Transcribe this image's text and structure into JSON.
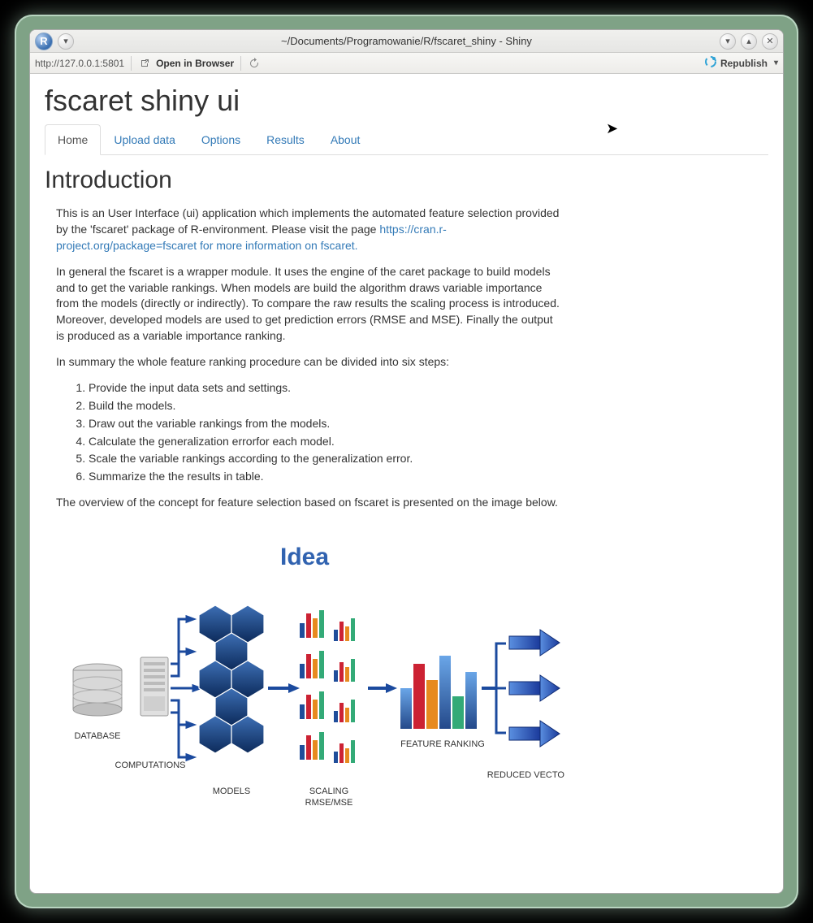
{
  "window": {
    "title": "~/Documents/Programowanie/R/fscaret_shiny - Shiny"
  },
  "toolbar": {
    "address": "http://127.0.0.1:5801",
    "open_in_browser": "Open in Browser",
    "republish": "Republish"
  },
  "page": {
    "title": "fscaret shiny ui",
    "tabs": [
      "Home",
      "Upload data",
      "Options",
      "Results",
      "About"
    ],
    "active_tab": 0,
    "section_title": "Introduction",
    "para1": "This is an User Interface (ui) application which implements the automated feature selection provided by the 'fscaret' package of R-environment. Please visit the page ",
    "link_text": "https://cran.r-project.org/package=fscaret for more information on fscaret.",
    "para2": "In general the fscaret is a wrapper module. It uses the engine of the caret package to build models and to get the variable rankings. When models are build the algorithm draws variable importance from the models (directly or indirectly). To compare the raw results the scaling process is introduced. Moreover, developed models are used to get prediction errors (RMSE and MSE). Finally the output is produced as a variable importance ranking.",
    "para3": "In summary the whole feature ranking procedure can be divided into six steps:",
    "steps": [
      "Provide the input data sets and settings.",
      "Build the models.",
      "Draw out the variable rankings from the models.",
      "Calculate the generalization errorfor each model.",
      "Scale the variable rankings according to the generalization error.",
      "Summarize the the results in table."
    ],
    "para4": "The overview of the concept for feature selection based on fscaret is presented on the image below."
  },
  "diagram": {
    "title": "Idea",
    "labels": {
      "database": "DATABASE",
      "computations": "COMPUTATIONS",
      "models": "MODELS",
      "scaling": "SCALING RMSE/MSE",
      "feature_ranking": "FEATURE RANKING",
      "reduced_vectors": "REDUCED VECTORS"
    }
  }
}
